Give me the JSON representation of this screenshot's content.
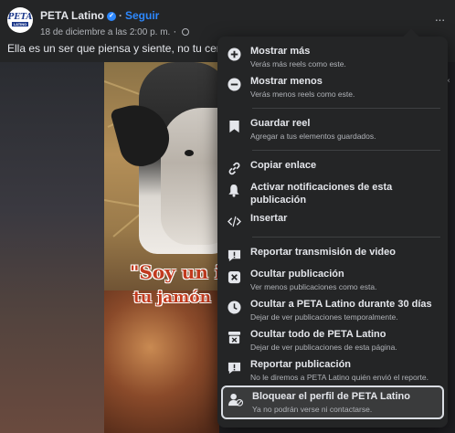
{
  "post": {
    "page_name": "PETA Latino",
    "follow_label": "Seguir",
    "separator": "·",
    "timestamp": "18 de diciembre a las 2:00 p. m.",
    "caption": "Ella es un ser que piensa y siente, no tu cena nav",
    "more_label": "···",
    "avatar_logo_top": "PETA",
    "avatar_logo_bottom": "LATINO",
    "verified_glyph": "✓"
  },
  "video": {
    "overlay_line1": "\"Soy un ir",
    "overlay_line2": "tu jamón",
    "close_glyph": "×"
  },
  "menu": {
    "items": [
      {
        "icon": "plus-circle-icon",
        "title": "Mostrar más",
        "subtitle": "Verás más reels como este."
      },
      {
        "icon": "minus-circle-icon",
        "title": "Mostrar menos",
        "subtitle": "Verás menos reels como este."
      },
      {
        "icon": "bookmark-icon",
        "title": "Guardar reel",
        "subtitle": "Agregar a tus elementos guardados."
      },
      {
        "icon": "link-icon",
        "title": "Copiar enlace",
        "subtitle": ""
      },
      {
        "icon": "bell-icon",
        "title": "Activar notificaciones de esta publicación",
        "subtitle": ""
      },
      {
        "icon": "embed-icon",
        "title": "Insertar",
        "subtitle": ""
      },
      {
        "icon": "report-flag-icon",
        "title": "Reportar transmisión de video",
        "subtitle": ""
      },
      {
        "icon": "close-box-icon",
        "title": "Ocultar publicación",
        "subtitle": "Ver menos publicaciones como esta."
      },
      {
        "icon": "clock-icon",
        "title": "Ocultar a PETA Latino durante 30 días",
        "subtitle": "Dejar de ver publicaciones temporalmente."
      },
      {
        "icon": "hide-all-icon",
        "title": "Ocultar todo de PETA Latino",
        "subtitle": "Dejar de ver publicaciones de esta página."
      },
      {
        "icon": "report-icon",
        "title": "Reportar publicación",
        "subtitle": "No le diremos a PETA Latino quién envió el reporte."
      },
      {
        "icon": "block-user-icon",
        "title": "Bloquear el perfil de PETA Latino",
        "subtitle": "Ya no podrán verse ni contactarse."
      }
    ]
  },
  "colors": {
    "background": "#242526",
    "text_primary": "#e4e6eb",
    "text_secondary": "#b0b3b8",
    "accent": "#2d88ff",
    "video_text": "#c23a1e"
  }
}
